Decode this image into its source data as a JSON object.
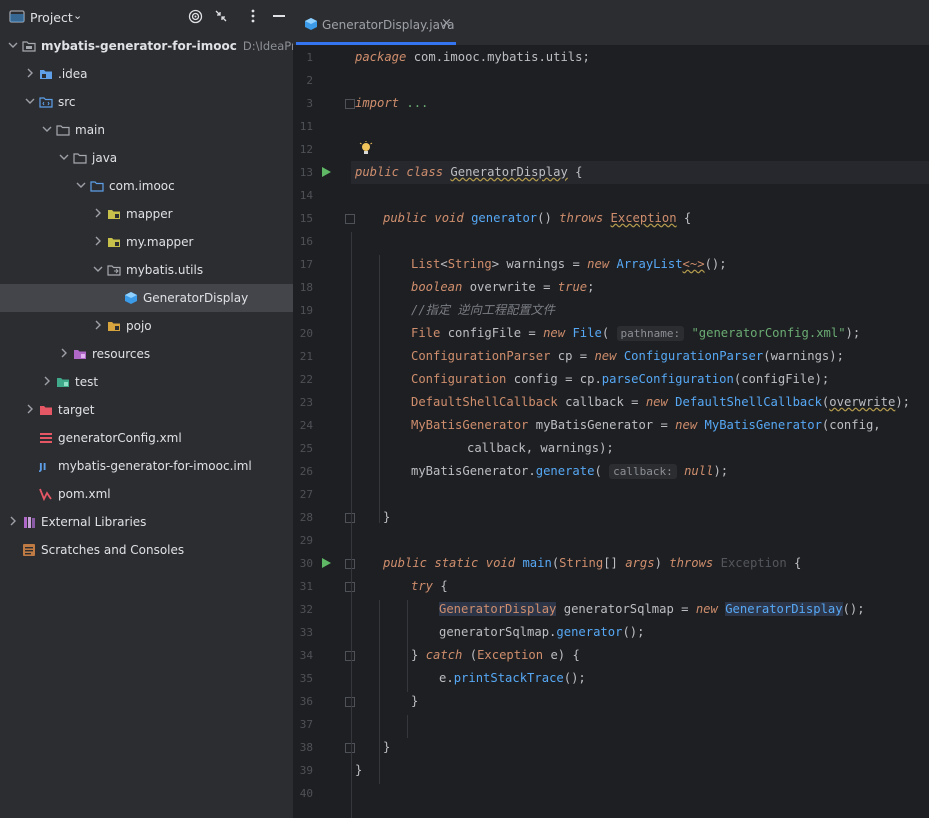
{
  "project_panel": {
    "title": "Project",
    "tree": [
      {
        "label": "mybatis-generator-for-imooc",
        "path": "D:\\IdeaProjects\\",
        "icon": "module-folder-icon",
        "arrow": "down"
      },
      {
        "label": ".idea",
        "icon": "idea-folder-icon",
        "arrow": "right"
      },
      {
        "label": "src",
        "icon": "source-folder-icon",
        "arrow": "down"
      },
      {
        "label": "main",
        "icon": "folder-icon",
        "arrow": "down"
      },
      {
        "label": "java",
        "icon": "folder-icon",
        "arrow": "down"
      },
      {
        "label": "com.imooc",
        "icon": "package-icon",
        "arrow": "down"
      },
      {
        "label": "mapper",
        "icon": "package-icon",
        "arrow": "right"
      },
      {
        "label": "my.mapper",
        "icon": "package-icon",
        "arrow": "right"
      },
      {
        "label": "mybatis.utils",
        "icon": "package-icon",
        "arrow": "down"
      },
      {
        "label": "GeneratorDisplay",
        "icon": "java-class-icon",
        "arrow": "none",
        "selected": true
      },
      {
        "label": "pojo",
        "icon": "package-icon",
        "arrow": "right"
      },
      {
        "label": "resources",
        "icon": "resources-folder-icon",
        "arrow": "right"
      },
      {
        "label": "test",
        "icon": "test-folder-icon",
        "arrow": "right"
      },
      {
        "label": "target",
        "icon": "excluded-folder-icon",
        "arrow": "right"
      },
      {
        "label": "generatorConfig.xml",
        "icon": "xml-file-icon",
        "arrow": "none"
      },
      {
        "label": "mybatis-generator-for-imooc.iml",
        "icon": "iml-file-icon",
        "arrow": "none"
      },
      {
        "label": "pom.xml",
        "icon": "maven-icon",
        "arrow": "none"
      },
      {
        "label": "External Libraries",
        "icon": "libraries-icon",
        "arrow": "right"
      },
      {
        "label": "Scratches and Consoles",
        "icon": "scratches-icon",
        "arrow": "none"
      }
    ]
  },
  "editor": {
    "tab": {
      "title": "GeneratorDisplay.java",
      "close": "×"
    },
    "line_numbers": [
      "1",
      "2",
      "3",
      "11",
      "12",
      "13",
      "14",
      "15",
      "16",
      "17",
      "18",
      "19",
      "20",
      "21",
      "22",
      "23",
      "24",
      "25",
      "26",
      "27",
      "28",
      "29",
      "30",
      "31",
      "32",
      "33",
      "34",
      "35",
      "36",
      "37",
      "38",
      "39",
      "40"
    ],
    "code": {
      "l1_kw": "package",
      "l1_rest": " com.imooc.mybatis.utils;",
      "l3_kw": "import",
      "l3_rest": " ...",
      "l13_a": "public",
      "l13_b": " ",
      "l13_c": "class",
      "l13_d": " ",
      "l13_e": "GeneratorDisplay",
      "l13_f": " {",
      "l15_a": "public",
      "l15_b": "void",
      "l15_c": "generator",
      "l15_d": "()",
      "l15_e": "throws",
      "l15_f": "Exception",
      "l15_g": " {",
      "l17_a": "List",
      "l17_b": "<",
      "l17_c": "String",
      "l17_d": ">",
      "l17_e": " warnings = ",
      "l17_f": "new",
      "l17_g": "ArrayList",
      "l17_h": "<~>",
      "l17_i": "();",
      "l18_a": "boolean",
      "l18_b": " overwrite = ",
      "l18_c": "true",
      "l18_d": ";",
      "l19_a": "//指定 逆向工程配置文件",
      "l20_a": "File",
      "l20_b": " configFile = ",
      "l20_c": "new",
      "l20_d": "File",
      "l20_e": "(",
      "l20_hint": "pathname:",
      "l20_f": "\"generatorConfig.xml\"",
      "l20_g": ");",
      "l21_a": "ConfigurationParser",
      "l21_b": " cp = ",
      "l21_c": "new",
      "l21_d": "ConfigurationParser",
      "l21_e": "(warnings);",
      "l22_a": "Configuration",
      "l22_b": " config = cp.",
      "l22_c": "parseConfiguration",
      "l22_d": "(configFile);",
      "l23_a": "DefaultShellCallback",
      "l23_b": " callback = ",
      "l23_c": "new",
      "l23_d": "DefaultShellCallback",
      "l23_e": "(",
      "l23_f": "overwrite",
      "l23_g": ");",
      "l24_a": "MyBatisGenerator",
      "l24_b": " myBatisGenerator = ",
      "l24_c": "new",
      "l24_d": "MyBatisGenerator",
      "l24_e": "(config,",
      "l25_a": "callback, warnings);",
      "l26_a": "myBatisGenerator.",
      "l26_b": "generate",
      "l26_c": "(",
      "l26_hint": "callback:",
      "l26_d": "null",
      "l26_e": ");",
      "l28_a": "}",
      "l30_a": "public",
      "l30_b": "static",
      "l30_c": "void",
      "l30_d": "main",
      "l30_e": "(",
      "l30_f": "String",
      "l30_g": "[] ",
      "l30_h": "args",
      "l30_i": ") ",
      "l30_j": "throws",
      "l30_k": " Exception",
      "l30_l": " {",
      "l31_a": "try",
      "l31_b": " {",
      "l32_a": "GeneratorDisplay",
      "l32_b": " generatorSqlmap = ",
      "l32_c": "new",
      "l32_d": "GeneratorDisplay",
      "l32_e": "();",
      "l33_a": "generatorSqlmap.",
      "l33_b": "generator",
      "l33_c": "();",
      "l34_a": "} ",
      "l34_b": "catch",
      "l34_c": " (",
      "l34_d": "Exception",
      "l34_e": " e) {",
      "l35_a": "e.",
      "l35_b": "printStackTrace",
      "l35_c": "();",
      "l36_a": "}",
      "l38_a": "}",
      "l39_a": "}"
    }
  },
  "colors": {
    "accent": "#3574f0",
    "run": "#5fb865",
    "bulb": "#f2c55c"
  }
}
